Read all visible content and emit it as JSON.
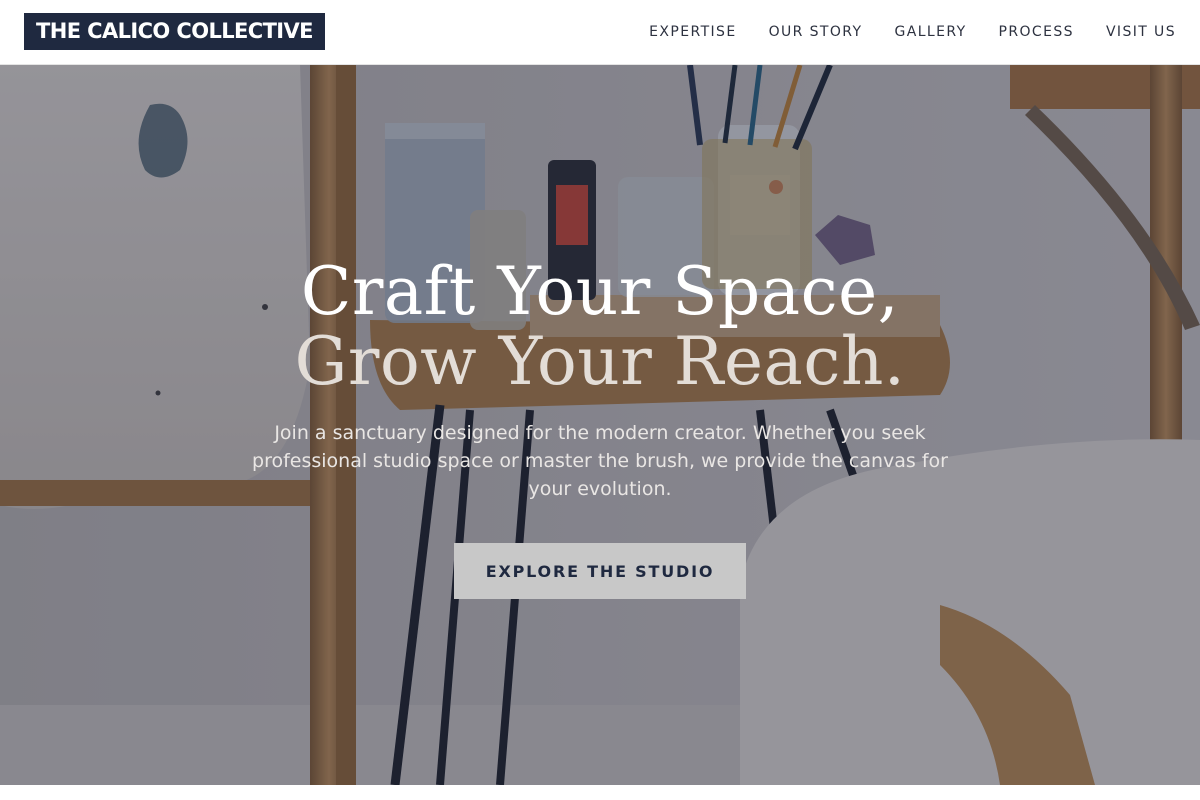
{
  "header": {
    "logo_text": "THE CALICO COLLECTIVE",
    "nav": [
      {
        "label": "EXPERTISE"
      },
      {
        "label": "OUR STORY"
      },
      {
        "label": "GALLERY"
      },
      {
        "label": "PROCESS"
      },
      {
        "label": "VISIT US"
      }
    ]
  },
  "hero": {
    "headline_line1": "Craft Your Space,",
    "headline_line2": "Grow Your Reach.",
    "subtext": "Join a sanctuary designed for the modern creator. Whether you seek professional studio space or master the brush, we provide the canvas for your evolution.",
    "cta_label": "EXPLORE THE STUDIO"
  },
  "colors": {
    "brand_navy": "#1f2940",
    "nav_text": "#2d3240",
    "cta_background": "#c8c8c8",
    "hero_overlay": "rgba(28, 32, 52, 0.42)"
  },
  "icons": {
    "hero_background": "art-studio-photo"
  }
}
